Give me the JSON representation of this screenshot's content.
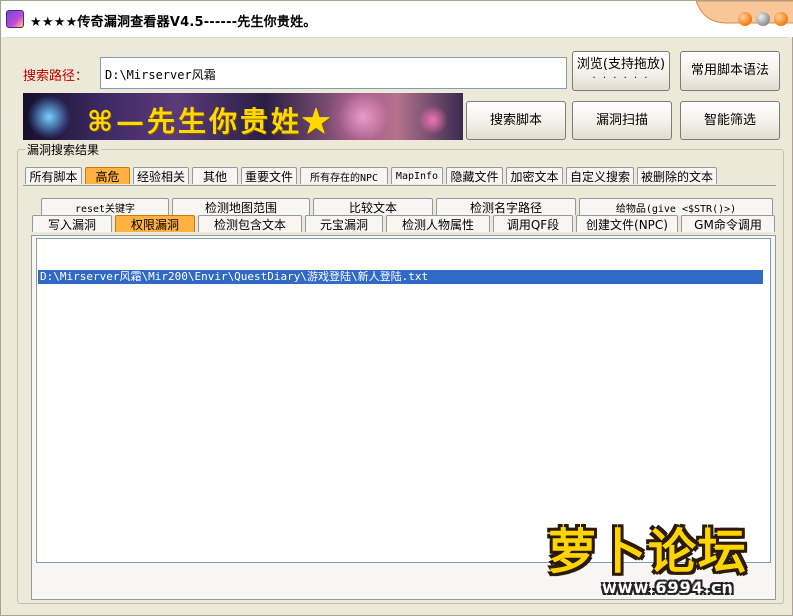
{
  "window": {
    "title": "★★★★传奇漏洞查看器V4.5------先生你贵姓。"
  },
  "search": {
    "label": "搜索路径：",
    "path_value": "D:\\Mirserver风霜"
  },
  "buttons": {
    "browse": "浏览(支持拖放)",
    "browse_dots": "· · · · · ·",
    "syntax": "常用脚本语法",
    "search_script": "搜索脚本",
    "scan": "漏洞扫描",
    "smart_filter": "智能筛选"
  },
  "banner": {
    "text": "⌘—先生你贵姓★"
  },
  "results": {
    "group_label": "漏洞搜索结果",
    "tabs_top": [
      "所有脚本",
      "高危",
      "经验相关",
      "其他",
      "重要文件",
      "所有存在的NPC",
      "MapInfo",
      "隐藏文件",
      "加密文本",
      "自定义搜索",
      "被删除的文本"
    ],
    "tabs_top_active": 1,
    "tabs_row2": [
      "reset关键字",
      "检测地图范围",
      "比较文本",
      "检测名字路径",
      "给物品(give <$STR()>)"
    ],
    "tabs_row3": [
      "写入漏洞",
      "权限漏洞",
      "检测包含文本",
      "元宝漏洞",
      "检测人物属性",
      "调用QF段",
      "创建文件(NPC)",
      "GM命令调用"
    ],
    "tabs_row3_active": 1,
    "list_items": [
      "D:\\Mirserver风霜\\Mir200\\Envir\\QuestDiary\\游戏登陆\\新人登陆.txt"
    ],
    "selected_index": 0
  },
  "watermark": {
    "logo": "萝卜论坛",
    "url": "www.6994.cn"
  },
  "colors": {
    "active_tab": "#ffb23f",
    "selection": "#316ac5",
    "label_red": "#c00000",
    "banner_text": "#ffd800"
  }
}
